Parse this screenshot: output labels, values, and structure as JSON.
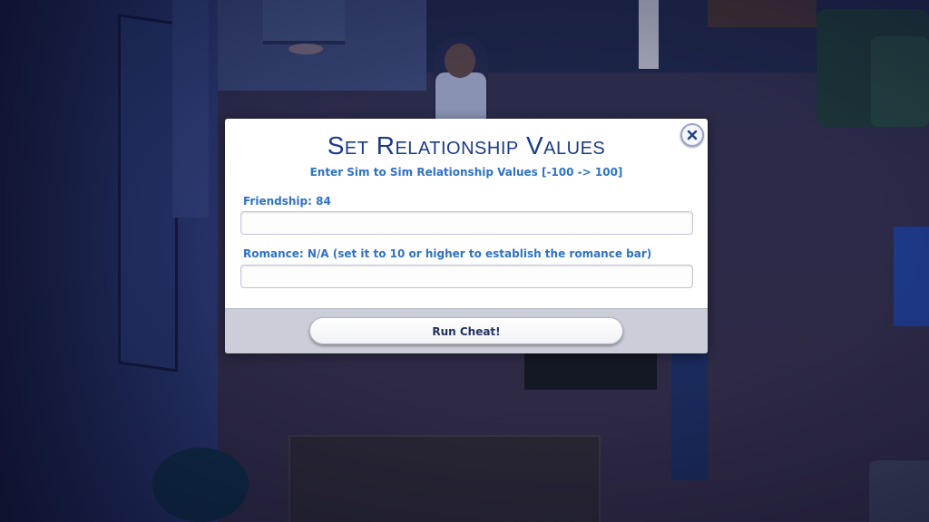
{
  "dialog": {
    "title": "Set Relationship Values",
    "subtitle": "Enter Sim to Sim Relationship Values [-100 -> 100]",
    "close_icon": "close-icon",
    "friendship": {
      "label": "Friendship: 84",
      "value": "",
      "placeholder": ""
    },
    "romance": {
      "label": "Romance: N/A (set it to 10 or higher to establish the romance bar)",
      "value": "",
      "placeholder": ""
    },
    "run_button_label": "Run Cheat!"
  },
  "colors": {
    "title": "#1a3a8a",
    "label": "#2f72c4",
    "footer": "#cbced9",
    "backdrop": "#1c2447"
  }
}
